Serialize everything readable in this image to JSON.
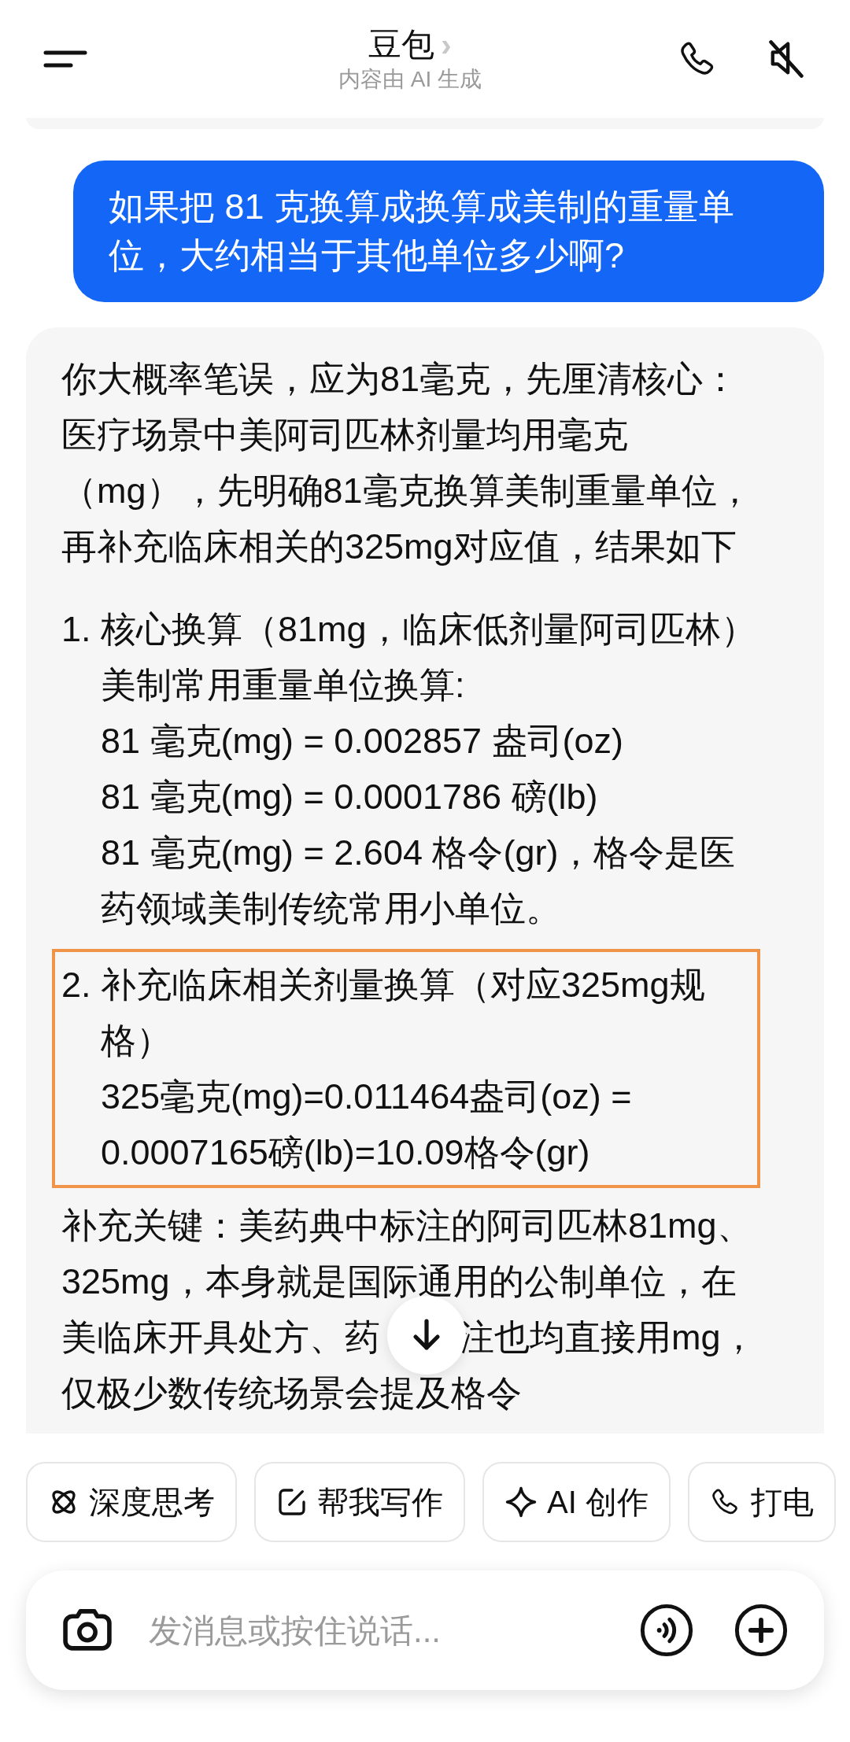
{
  "header": {
    "title": "豆包",
    "title_chevron": "›",
    "subtitle": "内容由 AI 生成"
  },
  "messages": [
    {
      "kind": "user",
      "text": "如果把 81 克换算成换算成美制的重量单位，大约相当于其他单位多少啊?"
    },
    {
      "kind": "assistant",
      "blocks": [
        {
          "kind": "paragraph",
          "text": "你大概率笔误，应为81毫克，先厘清核心：医疗场景中美阿司匹林剂量均用毫克（mg），先明确81毫克换算美制重量单位，再补充临床相关的325mg对应值，结果如下"
        },
        {
          "kind": "list_item",
          "number": "1.",
          "highlighted": false,
          "title": "核心换算（81mg，临床低剂量阿司匹林）",
          "lines": [
            "美制常用重量单位换算:",
            "81 毫克(mg) = 0.002857 盎司(oz)",
            "81 毫克(mg) = 0.0001786 磅(lb)",
            "81 毫克(mg) = 2.604 格令(gr)，格令是医药领域美制传统常用小单位。"
          ]
        },
        {
          "kind": "list_item",
          "number": "2.",
          "highlighted": true,
          "title": "补充临床相关剂量换算（对应325mg规格）",
          "lines": [
            "325毫克(mg)=0.011464盎司(oz) = 0.0007165磅(lb)=10.09格令(gr)"
          ]
        },
        {
          "kind": "covered_paragraph",
          "lines": [
            [
              "补充关键：美药典中标注的阿司匹林81mg、"
            ],
            [
              "325mg，本身就是国际通用的公制单位，在"
            ],
            [
              "美临床开具处方、药",
              "注也均直接用mg，"
            ],
            [
              "仅极少数传统场景会提及格令"
            ]
          ]
        }
      ]
    }
  ],
  "shortcuts": [
    {
      "kind": "atom",
      "label": "深度思考"
    },
    {
      "kind": "edit",
      "label": "帮我写作"
    },
    {
      "kind": "sparkle",
      "label": "AI 创作"
    },
    {
      "kind": "phone",
      "label": "打电"
    }
  ],
  "input": {
    "placeholder": "发消息或按住说话..."
  }
}
